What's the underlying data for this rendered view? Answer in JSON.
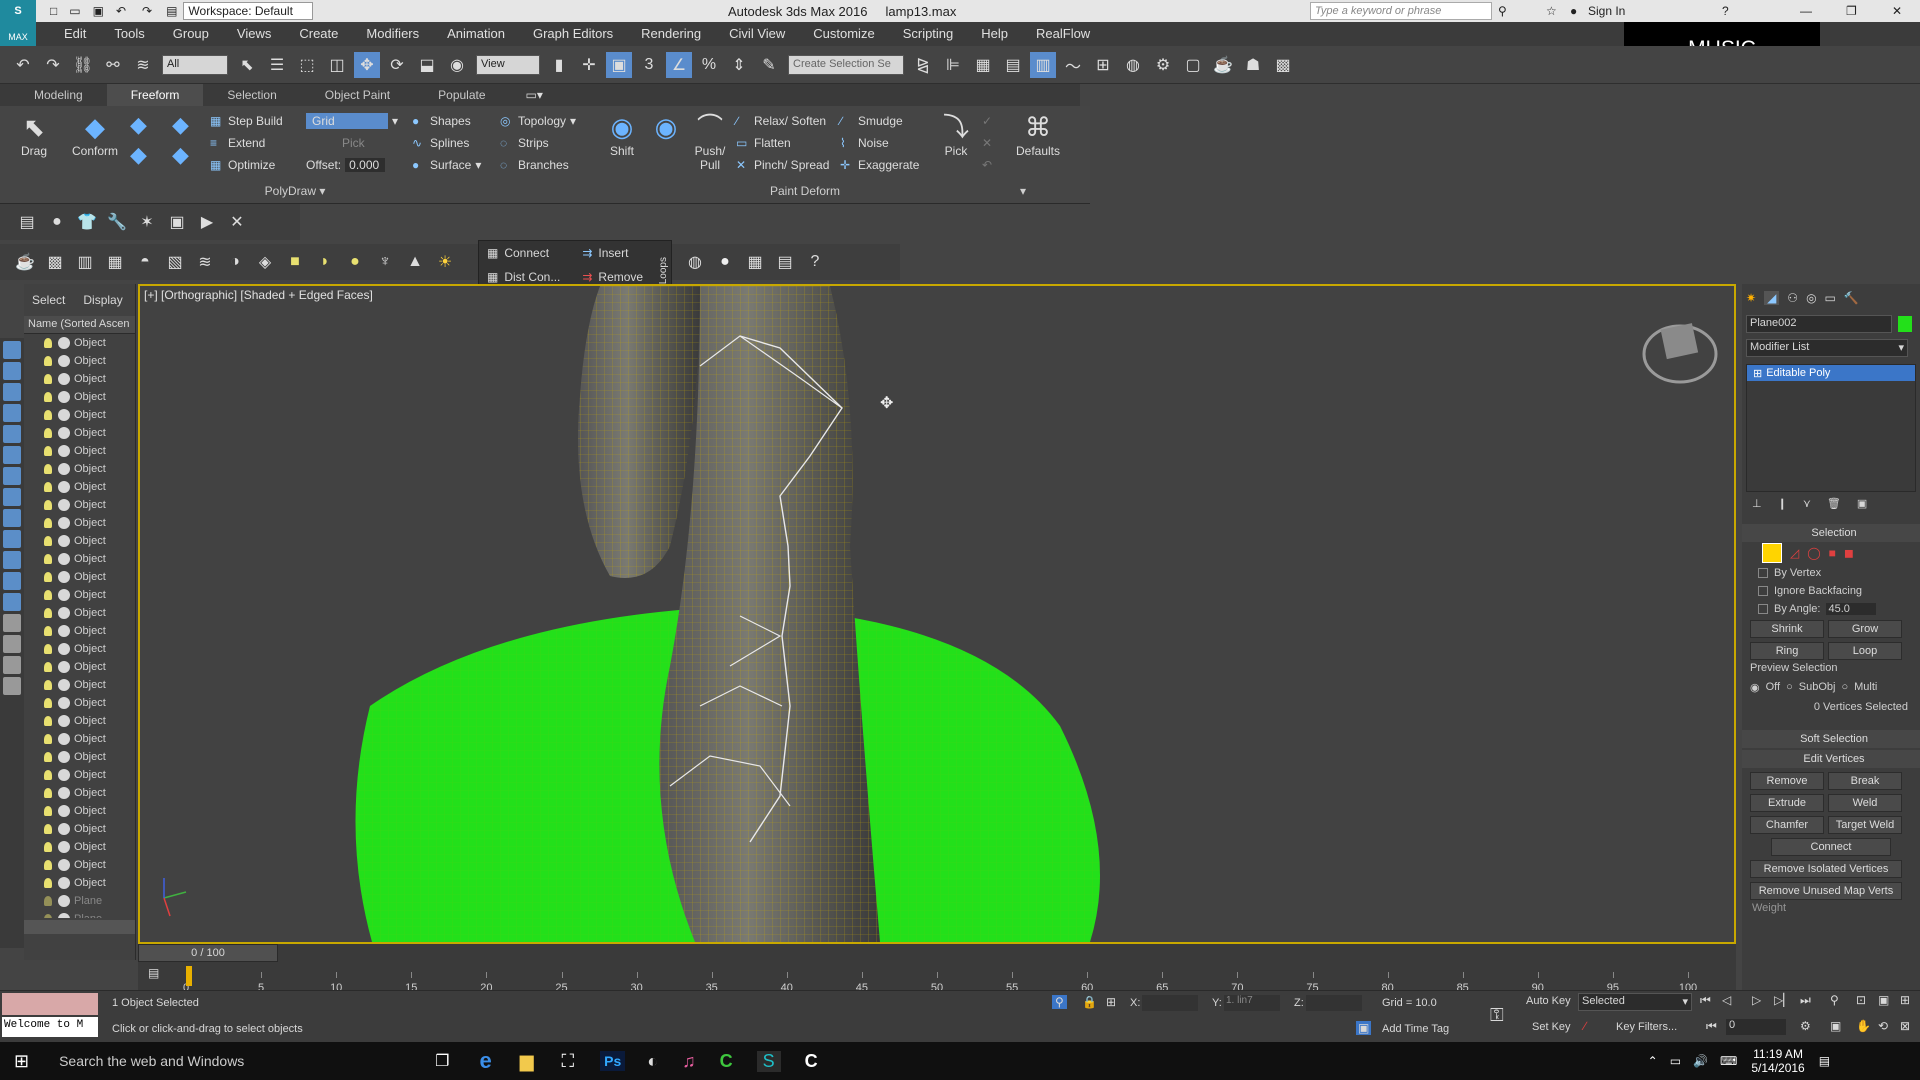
{
  "title_bar": {
    "workspace_label": "Workspace: Default",
    "title": "Autodesk 3ds Max 2016     lamp13.max",
    "search_placeholder": "Type a keyword or phrase",
    "sign_in": "Sign In"
  },
  "menu": [
    "Edit",
    "Tools",
    "Group",
    "Views",
    "Create",
    "Modifiers",
    "Animation",
    "Graph Editors",
    "Rendering",
    "Civil View",
    "Customize",
    "Scripting",
    "Help",
    "RealFlow"
  ],
  "toolbar": {
    "selection_filter": "All",
    "ref_coord": "View",
    "named_selection_placeholder": "Create Selection Se",
    "snap_label": "3"
  },
  "music_overlay": "MUSIC",
  "ribbon_tabs": [
    "Modeling",
    "Freeform",
    "Selection",
    "Object Paint",
    "Populate"
  ],
  "ribbon_active_tab": "Freeform",
  "ribbon": {
    "drag": "Drag",
    "conform": "Conform",
    "step_build": "Step Build",
    "extend": "Extend",
    "optimize": "Optimize",
    "grid": "Grid",
    "pick": "Pick",
    "offset_label": "Offset:",
    "offset_value": "0.000",
    "shapes": "Shapes",
    "splines": "Splines",
    "surface": "Surface",
    "topology": "Topology",
    "strips": "Strips",
    "branches": "Branches",
    "shift": "Shift",
    "push_pull_1": "Push/",
    "push_pull_2": "Pull",
    "relax_soften": "Relax/ Soften",
    "flatten": "Flatten",
    "pinch_spread": "Pinch/ Spread",
    "smudge": "Smudge",
    "noise": "Noise",
    "exaggerate": "Exaggerate",
    "pick2": "Pick",
    "defaults": "Defaults",
    "polydraw_label": "PolyDraw",
    "paint_deform_label": "Paint Deform"
  },
  "loops_popup": {
    "connect": "Connect",
    "insert": "Insert",
    "dist_con": "Dist Con...",
    "remove": "Remove",
    "side_label": "Loops"
  },
  "scene_explorer": {
    "tab_select": "Select",
    "tab_display": "Display",
    "column_header": "Name (Sorted Ascen",
    "rows": [
      "Object",
      "Object",
      "Object",
      "Object",
      "Object",
      "Object",
      "Object",
      "Object",
      "Object",
      "Object",
      "Object",
      "Object",
      "Object",
      "Object",
      "Object",
      "Object",
      "Object",
      "Object",
      "Object",
      "Object",
      "Object",
      "Object",
      "Object",
      "Object",
      "Object",
      "Object",
      "Object",
      "Object",
      "Object",
      "Object",
      "Object",
      "Plane",
      "Plane"
    ]
  },
  "viewport": {
    "label": "[+] [Orthographic] [Shaded + Edged Faces]"
  },
  "command_panel": {
    "object_name": "Plane002",
    "modifier_list": "Modifier List",
    "stack_item": "Editable Poly",
    "selection_title": "Selection",
    "by_vertex": "By Vertex",
    "ignore_backfacing": "Ignore Backfacing",
    "by_angle": "By Angle:",
    "by_angle_value": "45.0",
    "shrink": "Shrink",
    "grow": "Grow",
    "ring": "Ring",
    "loop": "Loop",
    "preview_selection": "Preview Selection",
    "preview_off": "Off",
    "preview_subobj": "SubObj",
    "preview_multi": "Multi",
    "vertices_selected": "0 Vertices Selected",
    "soft_selection": "Soft Selection",
    "edit_vertices": "Edit Vertices",
    "remove": "Remove",
    "break": "Break",
    "extrude": "Extrude",
    "weld": "Weld",
    "chamfer": "Chamfer",
    "target_weld": "Target Weld",
    "connect": "Connect",
    "remove_isolated": "Remove Isolated Vertices",
    "remove_unused": "Remove Unused Map Verts",
    "weight": "Weight"
  },
  "timeline": {
    "frame": "0 / 100",
    "ticks": [
      "0",
      "5",
      "10",
      "15",
      "20",
      "25",
      "30",
      "35",
      "40",
      "45",
      "50",
      "55",
      "60",
      "65",
      "70",
      "75",
      "80",
      "85",
      "90",
      "95",
      "100"
    ]
  },
  "status": {
    "welcome": "Welcome to M",
    "selected": "1 Object Selected",
    "prompt": "Click or click-and-drag to select objects",
    "x_label": "X:",
    "y_label": "Y:",
    "y_value": "1. lin7",
    "z_label": "Z:",
    "grid": "Grid = 10.0",
    "add_time_tag": "Add Time Tag",
    "auto_key": "Auto Key",
    "auto_key_sel": "Selected",
    "set_key": "Set Key",
    "key_filters": "Key Filters...",
    "frame_field": "0"
  },
  "taskbar": {
    "search": "Search the web and Windows",
    "time": "11:19 AM",
    "date": "5/14/2016"
  },
  "colors": {
    "active_viewport_border": "#c8a800",
    "selected_object": "#23e01a",
    "stack_highlight": "#3b76c8"
  }
}
